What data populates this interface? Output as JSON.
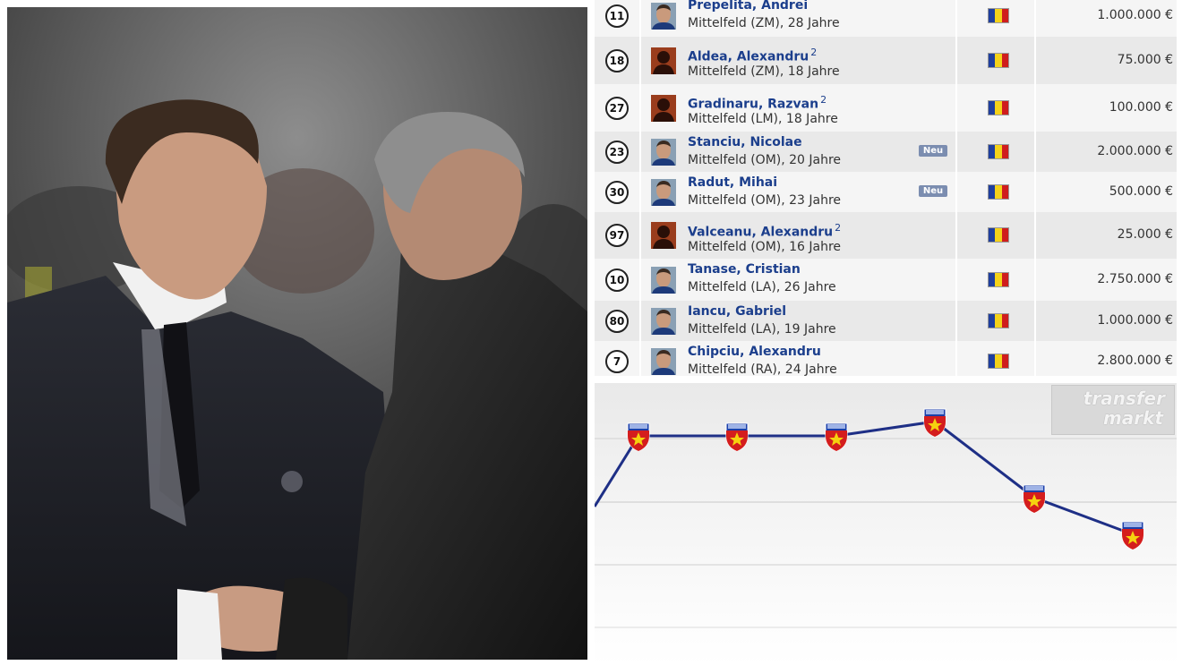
{
  "colors": {
    "player_link": "#1b3e8c",
    "chart_line": "#1e2f86",
    "row_odd": "#e9e9e9",
    "row_even": "#f5f5f5",
    "badge": "#7b8db0"
  },
  "players": [
    {
      "number": "11",
      "name": "Prepelita, Andrei",
      "mark": "",
      "position": "Mittelfeld (ZM), 28 Jahre",
      "badge": "",
      "value": "1.000.000 €",
      "photo": "face"
    },
    {
      "number": "18",
      "name": "Aldea, Alexandru",
      "mark": "2",
      "position": "Mittelfeld (ZM), 18 Jahre",
      "badge": "",
      "value": "75.000 €",
      "photo": "silhouette"
    },
    {
      "number": "27",
      "name": "Gradinaru, Razvan",
      "mark": "2",
      "position": "Mittelfeld (LM), 18 Jahre",
      "badge": "",
      "value": "100.000 €",
      "photo": "silhouette"
    },
    {
      "number": "23",
      "name": "Stanciu, Nicolae",
      "mark": "",
      "position": "Mittelfeld (OM), 20 Jahre",
      "badge": "Neu",
      "value": "2.000.000 €",
      "photo": "face"
    },
    {
      "number": "30",
      "name": "Radut, Mihai",
      "mark": "",
      "position": "Mittelfeld (OM), 23 Jahre",
      "badge": "Neu",
      "value": "500.000 €",
      "photo": "face"
    },
    {
      "number": "97",
      "name": "Valceanu, Alexandru",
      "mark": "2",
      "position": "Mittelfeld (OM), 16 Jahre",
      "badge": "",
      "value": "25.000 €",
      "photo": "silhouette"
    },
    {
      "number": "10",
      "name": "Tanase, Cristian",
      "mark": "",
      "position": "Mittelfeld (LA), 26 Jahre",
      "badge": "",
      "value": "2.750.000 €",
      "photo": "face"
    },
    {
      "number": "80",
      "name": "Iancu, Gabriel",
      "mark": "",
      "position": "Mittelfeld (LA), 19 Jahre",
      "badge": "",
      "value": "1.000.000 €",
      "photo": "face"
    },
    {
      "number": "7",
      "name": "Chipciu, Alexandru",
      "mark": "",
      "position": "Mittelfeld (RA), 24 Jahre",
      "badge": "",
      "value": "2.800.000 €",
      "photo": "face"
    }
  ],
  "chart": {
    "watermark_line1": "transfer",
    "watermark_line2": "markt",
    "points": [
      0.58,
      0.33,
      0.33,
      0.33,
      0.28,
      0.55,
      0.68
    ],
    "marker_icon": "steaua-crest-icon"
  },
  "photo": {
    "description_icon": "handshake-photo"
  }
}
